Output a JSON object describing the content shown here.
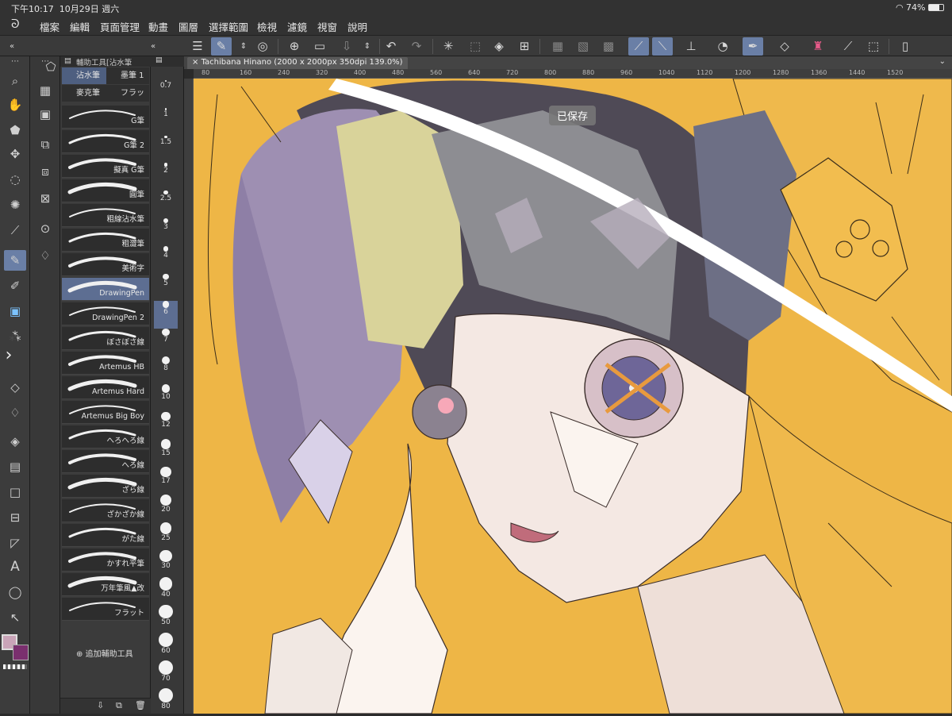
{
  "status": {
    "time": "下午10:17",
    "date": "10月29日 週六",
    "battery": "74%"
  },
  "menu": [
    "檔案",
    "編輯",
    "頁面管理",
    "動畫",
    "圖層",
    "選擇範圍",
    "檢視",
    "濾鏡",
    "視窗",
    "說明"
  ],
  "brush_panel": {
    "tab_label": "輔助工具[沾水筆",
    "categories": [
      "沾水筆",
      "墨筆 1",
      "麥克筆",
      "フラッ"
    ],
    "brushes": [
      "G筆",
      "G筆 2",
      "擬真 G筆",
      "圓筆",
      "粗線沾水筆",
      "粗澀筆",
      "美術字",
      "DrawingPen",
      "DrawingPen 2",
      "ぼさぼさ線",
      "Artemus HB",
      "Artemus Hard",
      "Artemus Big Boy",
      "へろへろ線",
      "へろ線",
      "ざら線",
      "ざかざか線",
      "がた線",
      "かすれ平筆",
      "万年筆風▲改",
      "フラット"
    ],
    "active_brush": "DrawingPen",
    "add_label": "追加輔助工具"
  },
  "sizes": [
    "0.7",
    "1",
    "1.5",
    "2",
    "2.5",
    "3",
    "4",
    "5",
    "6",
    "7",
    "8",
    "10",
    "12",
    "15",
    "17",
    "20",
    "25",
    "30",
    "40",
    "50",
    "60",
    "70",
    "80"
  ],
  "active_size": "6",
  "document": {
    "title": "Tachibana Hinano (2000 x 2000px 350dpi 139.0%)"
  },
  "ruler_ticks": [
    "80",
    "160",
    "240",
    "320",
    "400",
    "480",
    "560",
    "640",
    "720",
    "800",
    "880",
    "960",
    "1040",
    "1120",
    "1200",
    "1280",
    "1360",
    "1440",
    "1520"
  ],
  "toast": "已保存",
  "colors": {
    "main": "#c9a4b8",
    "sub": "#7a2f6e",
    "canvas_bg": "#eeb646",
    "accent": "#6a7fa6"
  }
}
